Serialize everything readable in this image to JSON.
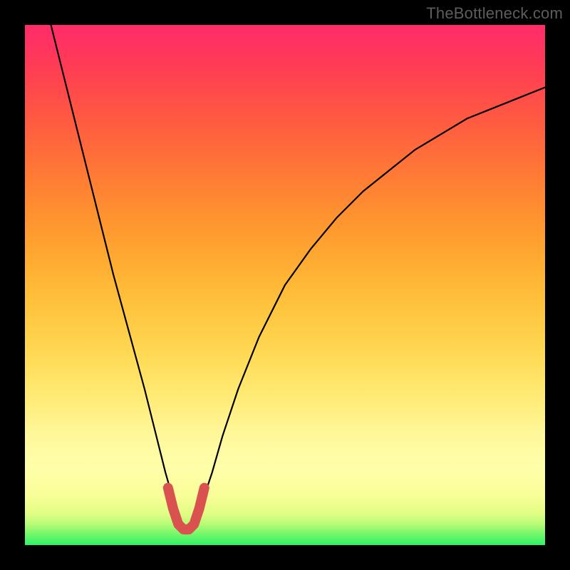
{
  "watermark": "TheBottleneck.com",
  "chart_data": {
    "type": "line",
    "title": "",
    "xlabel": "",
    "ylabel": "",
    "xlim": [
      0,
      100
    ],
    "ylim": [
      0,
      100
    ],
    "grid": false,
    "series": [
      {
        "name": "bottleneck-curve",
        "x": [
          5,
          8,
          11,
          14,
          17,
          20,
          23,
          25,
          27,
          29,
          30,
          31,
          32,
          34,
          36,
          38,
          41,
          45,
          50,
          55,
          60,
          65,
          70,
          75,
          80,
          85,
          90,
          95,
          100
        ],
        "values": [
          100,
          88,
          76,
          64,
          52,
          41,
          30,
          22,
          14,
          7,
          4,
          3,
          4,
          8,
          14,
          21,
          30,
          40,
          50,
          57,
          63,
          68,
          72,
          76,
          79,
          82,
          84,
          86,
          88
        ]
      },
      {
        "name": "minimum-marker",
        "x": [
          27.5,
          28.5,
          29.5,
          30.5,
          31.5,
          32.5,
          33.5,
          34.5
        ],
        "values": [
          11,
          7,
          4,
          3,
          3,
          4,
          7,
          11
        ]
      }
    ],
    "colors": {
      "curve": "#000000",
      "marker": "#d9524f"
    },
    "annotations": []
  }
}
